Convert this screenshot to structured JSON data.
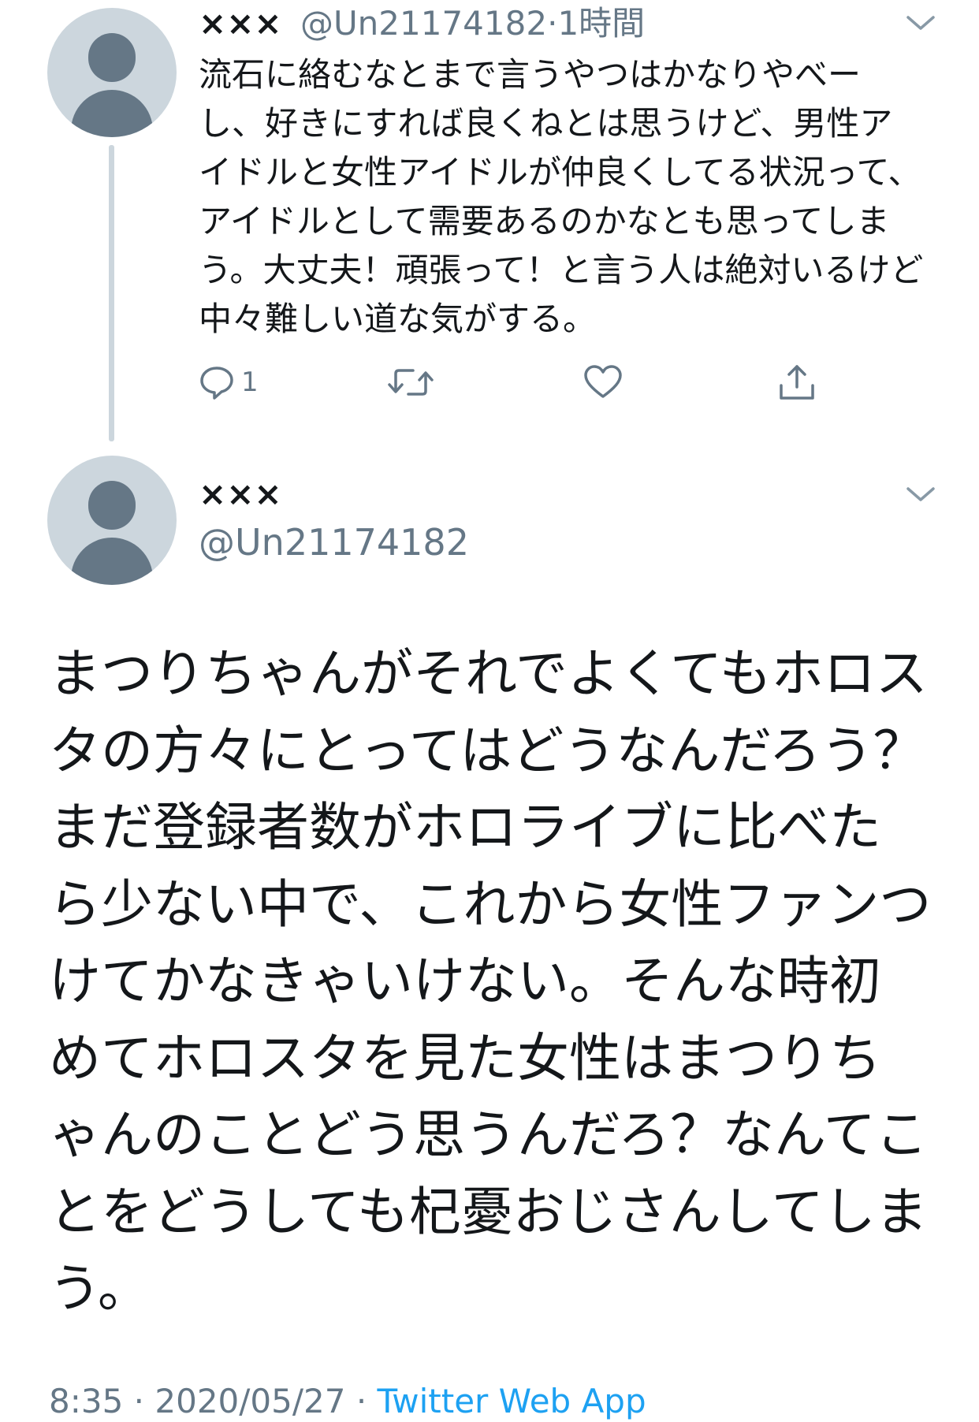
{
  "reply": {
    "name": "×××",
    "handle": "@Un21174182",
    "separator": "·",
    "time": "1時間",
    "text": "流石に絡むなとまで言うやつはかなりやべーし、好きにすれば良くねとは思うけど、男性アイドルと女性アイドルが仲良くしてる状況って、アイドルとして需要あるのかなとも思ってしまう。大丈夫！頑張って！と言う人は絶対いるけど中々難しい道な気がする。",
    "reply_count": "1"
  },
  "main": {
    "name": "×××",
    "handle": "@Un21174182",
    "text": "まつりちゃんがそれでよくてもホロスタの方々にとってはどうなんだろう？まだ登録者数がホロライブに比べたら少ない中で、これから女性ファンつけてかなきゃいけない。そんな時初めてホロスタを見た女性はまつりちゃんのことどう思うんだろ？なんてことをどうしても杞憂おじさんしてしまう。"
  },
  "footer": {
    "time": "8:35",
    "sep1": " · ",
    "date": "2020/05/27",
    "sep2": " · ",
    "source": "Twitter Web App"
  },
  "colors": {
    "muted": "#657786",
    "link": "#1da1f2",
    "avatar_bg": "#ccd6dd",
    "text": "#14171a"
  },
  "icons": {
    "reply": "reply-icon",
    "retweet": "retweet-icon",
    "like": "heart-icon",
    "share": "share-icon",
    "menu": "chevron-down-icon"
  }
}
